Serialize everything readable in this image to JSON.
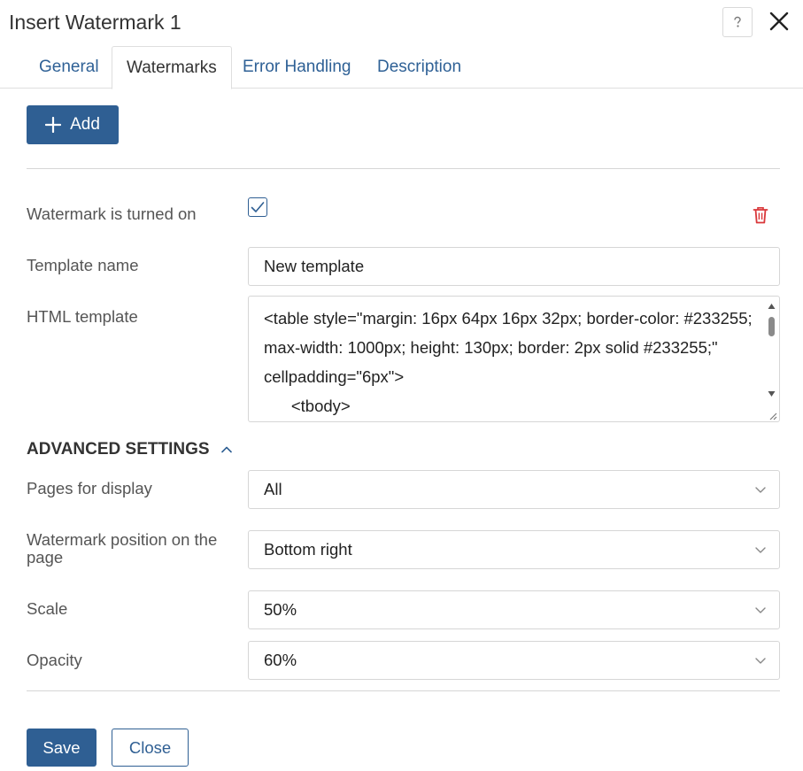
{
  "dialog": {
    "title": "Insert Watermark 1"
  },
  "tabs": [
    {
      "label": "General"
    },
    {
      "label": "Watermarks"
    },
    {
      "label": "Error Handling"
    },
    {
      "label": "Description"
    }
  ],
  "toolbar": {
    "add_label": "Add"
  },
  "watermark": {
    "enabled_label": "Watermark is turned on",
    "enabled": true,
    "template_name_label": "Template name",
    "template_name_value": "New template",
    "html_template_label": "HTML template",
    "html_template_value": "<table style=\"margin: 16px 64px 16px 32px; border-color: #233255; max-width: 1000px; height: 130px; border: 2px solid #233255;\" cellpadding=\"6px\">\n      <tbody>"
  },
  "advanced": {
    "heading": "ADVANCED SETTINGS",
    "pages_label": "Pages for display",
    "pages_value": "All",
    "position_label": "Watermark position on the page",
    "position_value": "Bottom right",
    "scale_label": "Scale",
    "scale_value": "50%",
    "opacity_label": "Opacity",
    "opacity_value": "60%"
  },
  "footer": {
    "save_label": "Save",
    "close_label": "Close"
  },
  "colors": {
    "primary": "#2f5f93",
    "link": "#2f6196",
    "danger": "#d9373a"
  }
}
